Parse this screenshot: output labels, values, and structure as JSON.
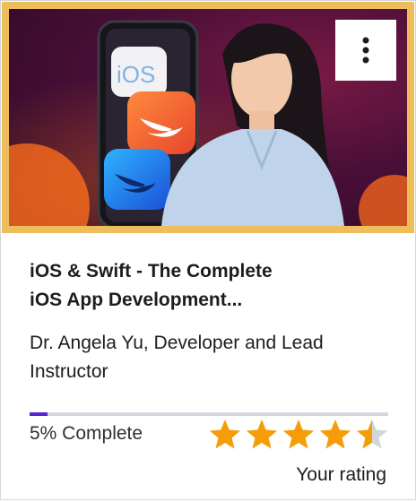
{
  "course": {
    "title": "iOS & Swift - The Complete\niOS App Development...",
    "instructor": "Dr. Angela Yu, Developer and Lead Instructor",
    "thumbnail_badge": "iOS"
  },
  "progress": {
    "percent": 5,
    "label": "5% Complete"
  },
  "rating": {
    "value": 4.5,
    "max": 5,
    "label": "Your rating"
  },
  "menu": {
    "icon": "kebab-menu-icon"
  },
  "colors": {
    "thumbnail_border": "#efbe5c",
    "progress_fill": "#5624d0",
    "progress_track": "#d1d7dc",
    "star": "#f69c08",
    "star_empty": "#d1d7dc"
  }
}
